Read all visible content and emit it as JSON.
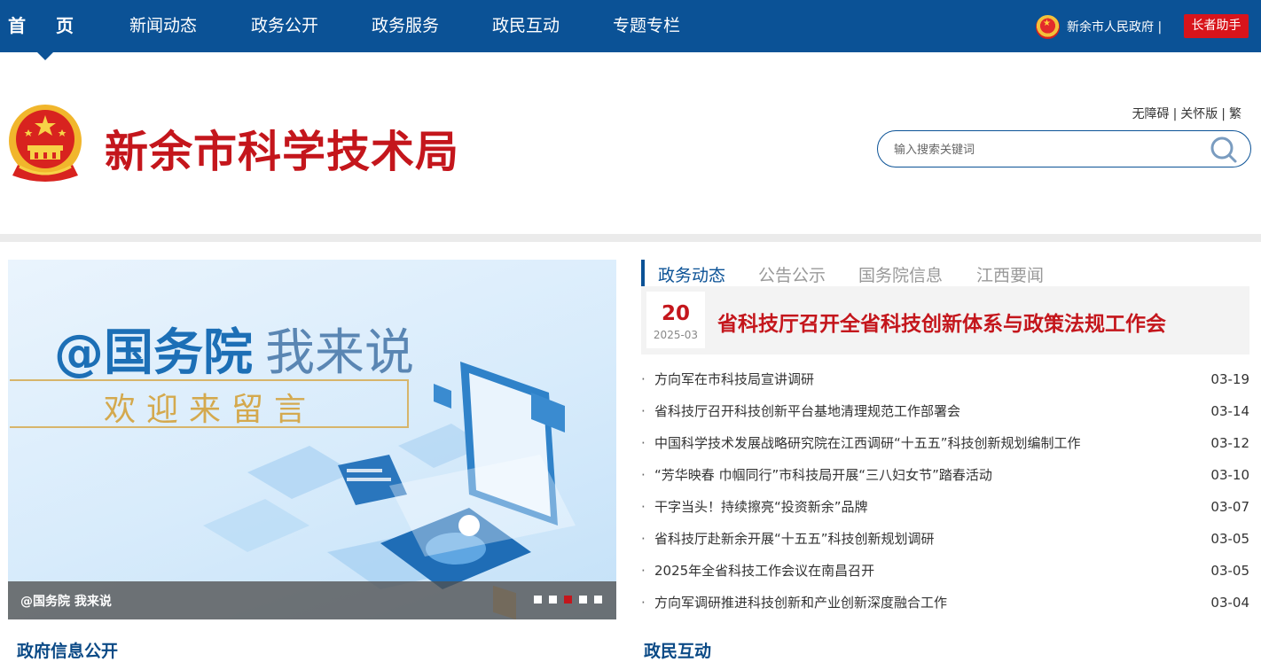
{
  "nav": {
    "items": [
      {
        "label": "首页"
      },
      {
        "label": "新闻动态"
      },
      {
        "label": "政务公开"
      },
      {
        "label": "政务服务"
      },
      {
        "label": "政民互动"
      },
      {
        "label": "专题专栏"
      }
    ],
    "gov_link": "新余市人民政府 |",
    "elder_button": "长者助手"
  },
  "header": {
    "site_title": "新余市科学技术局",
    "util_links": [
      "无障碍",
      "关怀版",
      "繁"
    ],
    "util_sep": "|",
    "search_placeholder": "输入搜索关键词"
  },
  "banner": {
    "title_main": "@国务院",
    "title_light": "我来说",
    "subtitle": "欢迎来留言",
    "caption": "@国务院 我来说",
    "slide_count": 5,
    "active_slide": 3
  },
  "news": {
    "tabs": [
      {
        "label": "政务动态",
        "active": true
      },
      {
        "label": "公告公示",
        "active": false
      },
      {
        "label": "国务院信息",
        "active": false
      },
      {
        "label": "江西要闻",
        "active": false
      }
    ],
    "headline": {
      "day": "20",
      "year_month": "2025-03",
      "title": "省科技厅召开全省科技创新体系与政策法规工作会"
    },
    "bullet": "·",
    "items": [
      {
        "title": "方向军在市科技局宣讲调研",
        "date": "03-19"
      },
      {
        "title": "省科技厅召开科技创新平台基地清理规范工作部署会",
        "date": "03-14"
      },
      {
        "title": "中国科学技术发展战略研究院在江西调研“十五五”科技创新规划编制工作",
        "date": "03-12"
      },
      {
        "title": "“芳华映春 巾帼同行”市科技局开展“三八妇女节”踏春活动",
        "date": "03-10"
      },
      {
        "title": "干字当头！持续擦亮“投资新余”品牌",
        "date": "03-07"
      },
      {
        "title": "省科技厅赴新余开展“十五五”科技创新规划调研",
        "date": "03-05"
      },
      {
        "title": "2025年全省科技工作会议在南昌召开",
        "date": "03-05"
      },
      {
        "title": "方向军调研推进科技创新和产业创新深度融合工作",
        "date": "03-04"
      }
    ]
  },
  "sections": {
    "left_title": "政府信息公开",
    "right_title": "政民互动"
  },
  "colors": {
    "nav_bg": "#0b5296",
    "accent_red": "#c4161c",
    "section_blue": "#0b4a86"
  }
}
